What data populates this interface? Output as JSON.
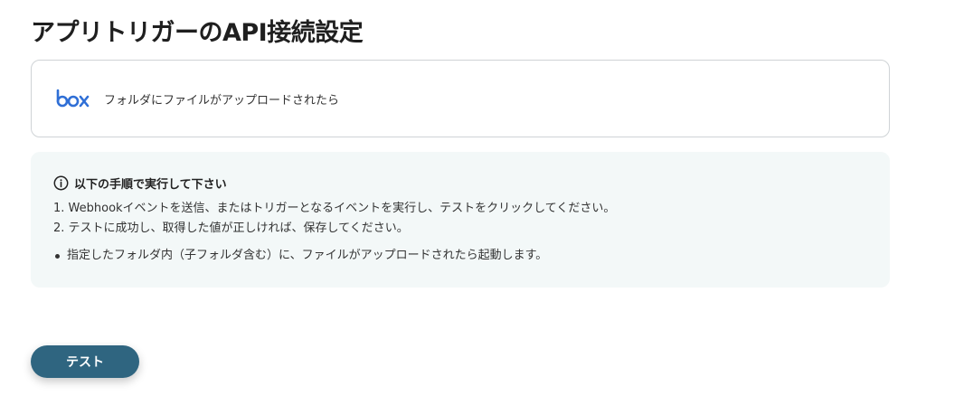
{
  "page": {
    "title": "アプリトリガーのAPI接続設定"
  },
  "trigger": {
    "app_icon": "box-logo",
    "label": "フォルダにファイルがアップロードされたら"
  },
  "instructions": {
    "icon": "info-icon",
    "heading": "以下の手順で実行して下さい",
    "steps": [
      "1. Webhookイベントを送信、またはトリガーとなるイベントを実行し、テストをクリックしてください。",
      "2. テストに成功し、取得した値が正しければ、保存してください。"
    ],
    "notes": [
      "指定したフォルダ内（子フォルダ含む）に、ファイルがアップロードされたら起動します。"
    ]
  },
  "actions": {
    "test_label": "テスト"
  },
  "colors": {
    "brand_box": "#2f6fd6",
    "button": "#2f6580",
    "panel_bg": "#f3f8f8",
    "card_border": "#cfd3d6"
  }
}
